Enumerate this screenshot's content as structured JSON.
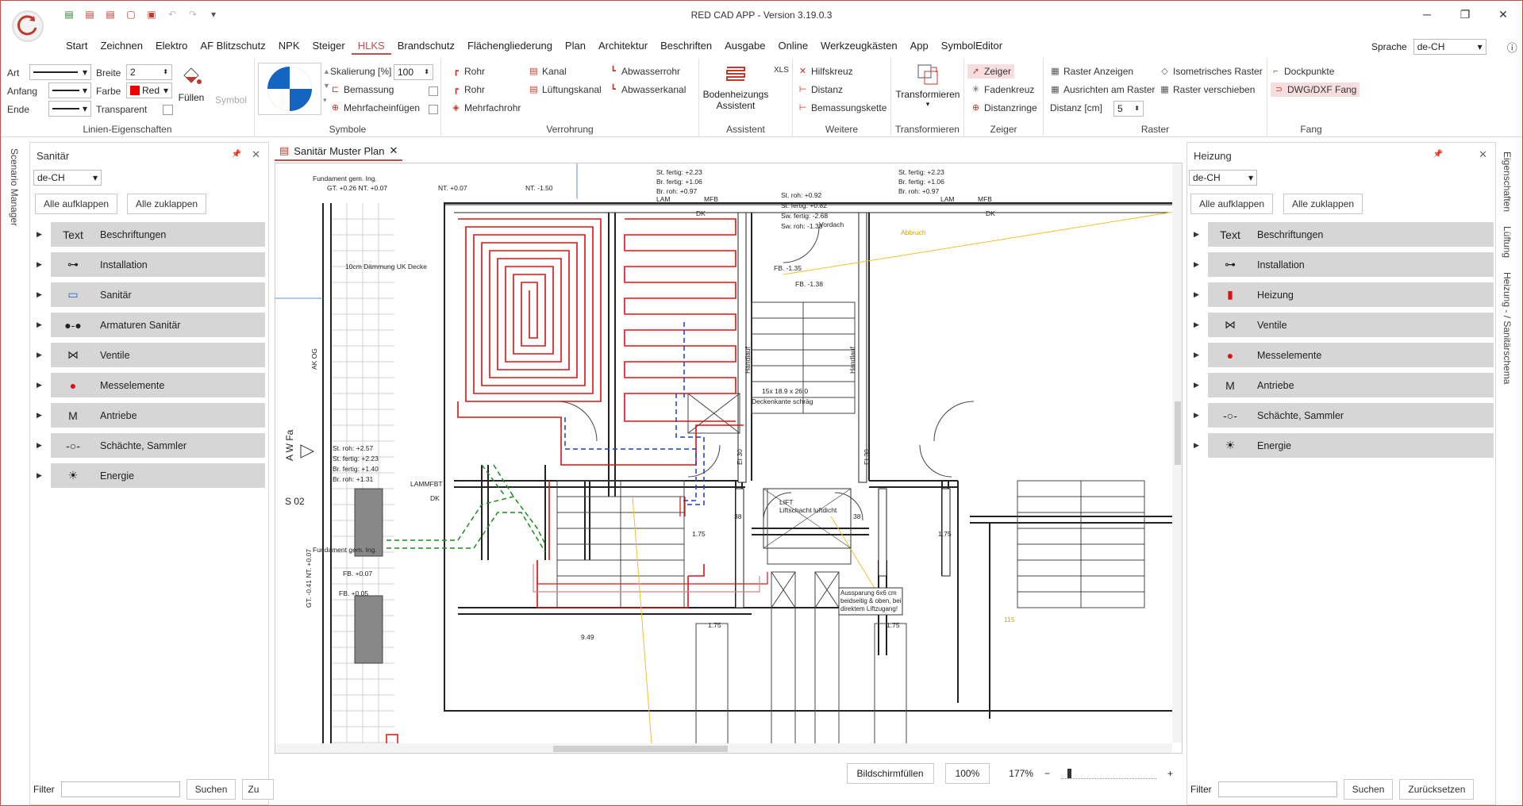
{
  "app": {
    "title": "RED CAD APP - Version 3.19.0.3",
    "language_label": "Sprache",
    "language": "de-CH"
  },
  "qat": {
    "icons": [
      "new-file-icon",
      "open-pdf-icon",
      "open-pdf-2-icon",
      "open-folder-icon",
      "save-icon",
      "undo-icon",
      "redo-icon",
      "customize-icon"
    ]
  },
  "menu": [
    "Start",
    "Zeichnen",
    "Elektro",
    "AF Blitzschutz",
    "NPK",
    "Steiger",
    "HLKS",
    "Brandschutz",
    "Flächengliederung",
    "Plan",
    "Architektur",
    "Beschriften",
    "Ausgabe",
    "Online",
    "Werkzeugkästen",
    "App",
    "SymbolEditor"
  ],
  "ribbon": {
    "linien": {
      "label": "Linien-Eigenschaften",
      "art": "Art",
      "anfang": "Anfang",
      "ende": "Ende",
      "breite": "Breite",
      "breite_val": "2",
      "farbe": "Farbe",
      "farbe_val": "Red",
      "transparent": "Transparent",
      "fuellen": "Füllen",
      "symbol": "Symbol"
    },
    "symbole": {
      "label": "Symbole",
      "skalierung": "Skalierung [%]",
      "skalierung_val": "100",
      "bemassung": "Bemassung",
      "mehrfach": "Mehrfacheinfügen"
    },
    "verrohrung": {
      "label": "Verrohrung",
      "rohr1": "Rohr",
      "rohr2": "Rohr",
      "mehrfachrohr": "Mehrfachrohr",
      "kanal": "Kanal",
      "lueftungskanal": "Lüftungskanal",
      "abwasserrohr": "Abwasserrohr",
      "abwasserkanal": "Abwasserkanal"
    },
    "assistent": {
      "label": "Assistent",
      "bodenheizung": "Bodenheizungs Assistent",
      "xls": "XLS"
    },
    "weitere": {
      "label": "Weitere",
      "hilfskreuz": "Hilfskreuz",
      "distanz": "Distanz",
      "bemassungskette": "Bemassungskette"
    },
    "transformieren": {
      "label": "Transformieren",
      "btn": "Transformieren"
    },
    "zeiger": {
      "label": "Zeiger",
      "zeiger": "Zeiger",
      "fadenkreuz": "Fadenkreuz",
      "distanzringe": "Distanzringe"
    },
    "raster": {
      "label": "Raster",
      "anzeigen": "Raster Anzeigen",
      "ausrichten": "Ausrichten am Raster",
      "distanz": "Distanz [cm]",
      "distanz_val": "5",
      "iso": "Isometrisches Raster",
      "verschieben": "Raster verschieben"
    },
    "fang": {
      "label": "Fang",
      "dock": "Dockpunkte",
      "dwg": "DWG/DXF Fang"
    }
  },
  "left_panel": {
    "title": "Sanitär",
    "lang": "de-CH",
    "expand": "Alle aufklappen",
    "collapse": "Alle zuklappen",
    "items": [
      {
        "label": "Beschriftungen",
        "sym": "Text"
      },
      {
        "label": "Installation",
        "sym": "⊶"
      },
      {
        "label": "Sanitär",
        "sym": "▭"
      },
      {
        "label": "Armaturen Sanitär",
        "sym": "●-●"
      },
      {
        "label": "Ventile",
        "sym": "⋈"
      },
      {
        "label": "Messelemente",
        "sym": "●"
      },
      {
        "label": "Antriebe",
        "sym": "M"
      },
      {
        "label": "Schächte, Sammler",
        "sym": "-○-"
      },
      {
        "label": "Energie",
        "sym": "☀"
      }
    ],
    "filter": "Filter",
    "search": "Suchen",
    "reset": "Zu"
  },
  "right_panel": {
    "title": "Heizung",
    "lang": "de-CH",
    "expand": "Alle aufklappen",
    "collapse": "Alle zuklappen",
    "items": [
      {
        "label": "Beschriftungen",
        "sym": "Text"
      },
      {
        "label": "Installation",
        "sym": "⊶"
      },
      {
        "label": "Heizung",
        "sym": "▮"
      },
      {
        "label": "Ventile",
        "sym": "⋈"
      },
      {
        "label": "Messelemente",
        "sym": "●"
      },
      {
        "label": "Antriebe",
        "sym": "M"
      },
      {
        "label": "Schächte, Sammler",
        "sym": "-○-"
      },
      {
        "label": "Energie",
        "sym": "☀"
      }
    ],
    "filter": "Filter",
    "search": "Suchen",
    "reset": "Zurücksetzen"
  },
  "side_tabs": {
    "left": "Scenario Manager",
    "right1": "Eigenschaften",
    "right2": "Lüftung",
    "right3": "Heizung - / Sanitärschema"
  },
  "document": {
    "tab": "Sanitär Muster Plan",
    "fit": "Bildschirmfüllen",
    "zoom_btn": "100%",
    "zoom": "177%",
    "labels": {
      "fundament1": "Fundament gem. Ing.",
      "gt1": "GT. +0.26 NT. +0.07",
      "nt1": "NT. +0.07",
      "nt2": "NT. -1.50",
      "daemmung": "10cm Dämmung UK Decke",
      "akog": "AK OG",
      "awfa": "A W Fa",
      "s02": "S 02",
      "lammfbt": "LAMMFBT",
      "dk": "DK",
      "lam": "LAM",
      "mfb": "MFB",
      "fundament2": "Fundament gem. Ing.",
      "fb007": "FB. +0.07",
      "fb005": "FB. +0.05",
      "gt2": "GT. -0.41 NT. +0.07",
      "lift": "LIFT",
      "liftschacht": "Liftschacht luftdicht",
      "aussparung": "Aussparung 6x6 cm beidseitig & oben, bei direktem Liftzugang!",
      "stair": "15x 18.9 x 26.0",
      "deckenkante": "Deckenkante schräg",
      "fb135": "FB. -1.35",
      "fb138": "FB. -1.38",
      "vordach": "Vordach",
      "abbruch": "Abbruch",
      "ei30": "EI 30",
      "dim175": "1.75",
      "dim38": "38",
      "dim949": "9.49",
      "dim115": "115",
      "handlauf": "Handlauf",
      "strow_a": "St. roh: +2.57",
      "strow_b": "St. fertig: +2.23",
      "strow_c": "Br. fertig: +1.40",
      "strow_d": "Br. roh: +1.31",
      "st2a": "St. roh: +0.92",
      "st2b": "St. fertig: +0.82",
      "st2c": "Sw. fertig: -2.68",
      "st2d": "Sw. roh: -1.38",
      "st3a": "St. fertig: +2.23",
      "st3b": "Br. fertig: +1.06",
      "st3c": "Br. roh: +0.97"
    }
  }
}
